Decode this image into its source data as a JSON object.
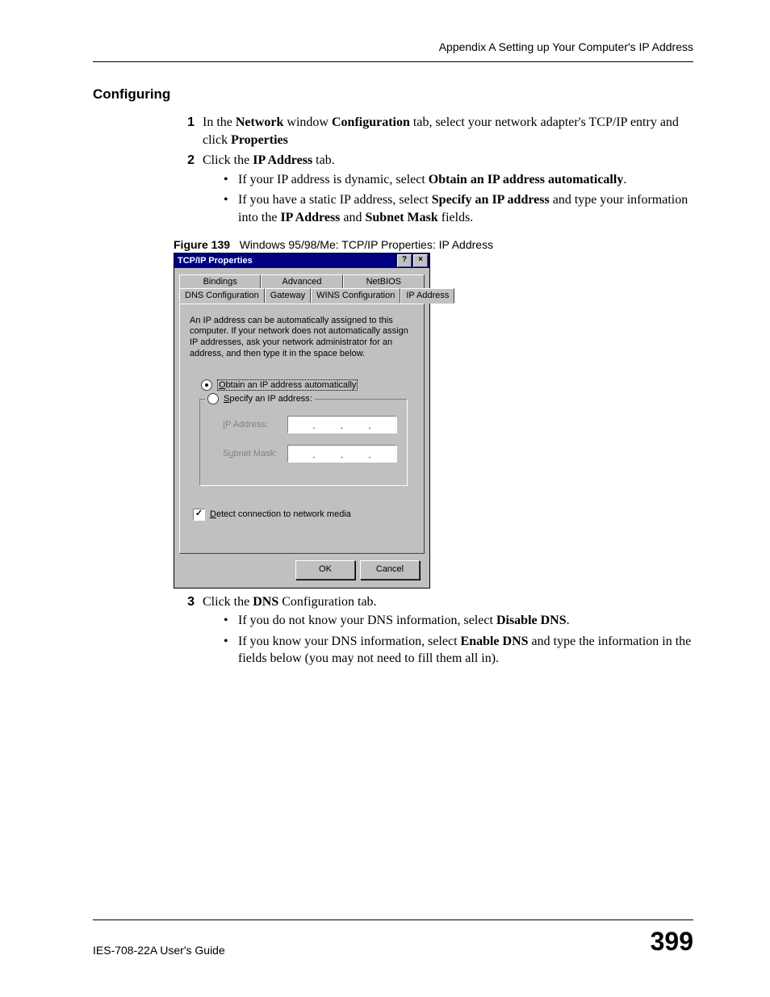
{
  "header": {
    "running_head": "Appendix A Setting up Your Computer's IP Address"
  },
  "section": {
    "title": "Configuring",
    "steps": {
      "s1": {
        "num": "1",
        "pre": "In the ",
        "b1": "Network",
        "mid1": " window ",
        "b2": "Configuration",
        "mid2": " tab, select your network adapter's TCP/IP entry and click ",
        "b3": "Properties"
      },
      "s2": {
        "num": "2",
        "pre": "Click the ",
        "b1": "IP Address",
        "post": " tab."
      },
      "s2a": {
        "pre": "If your IP address is dynamic, select ",
        "b1": "Obtain an IP address automatically",
        "post": "."
      },
      "s2b": {
        "pre": "If you have a static IP address, select ",
        "b1": "Specify an IP address",
        "mid1": " and type your information into the ",
        "b2": "IP Address",
        "mid2": " and ",
        "b3": "Subnet Mask",
        "post": " fields."
      },
      "s3": {
        "num": "3",
        "pre": "Click the ",
        "b1": "DNS",
        "post": " Configuration tab."
      },
      "s3a": {
        "pre": "If you do not know your DNS information, select ",
        "b1": "Disable DNS",
        "post": "."
      },
      "s3b": {
        "pre": "If you know your DNS information, select ",
        "b1": "Enable DNS",
        "post": " and type the information in the fields below (you may not need to fill them all in)."
      }
    }
  },
  "figure": {
    "label": "Figure 139",
    "caption": "Windows 95/98/Me: TCP/IP Properties: IP Address"
  },
  "dialog": {
    "title": "TCP/IP Properties",
    "help_btn": "?",
    "close_btn": "×",
    "tabs_back": [
      "Bindings",
      "Advanced",
      "NetBIOS"
    ],
    "tabs_front": [
      "DNS Configuration",
      "Gateway",
      "WINS Configuration",
      "IP Address"
    ],
    "active_tab_index": 3,
    "info": "An IP address can be automatically assigned to this computer. If your network does not automatically assign IP addresses, ask your network administrator for an address, and then type it in the space below.",
    "radio_obtain": "Obtain an IP address automatically",
    "radio_specify": "Specify an IP address:",
    "field_ip": "IP Address:",
    "field_mask": "Subnet Mask:",
    "check_detect": "Detect connection to network media",
    "ok": "OK",
    "cancel": "Cancel"
  },
  "footer": {
    "guide": "IES-708-22A User's Guide",
    "page": "399"
  }
}
